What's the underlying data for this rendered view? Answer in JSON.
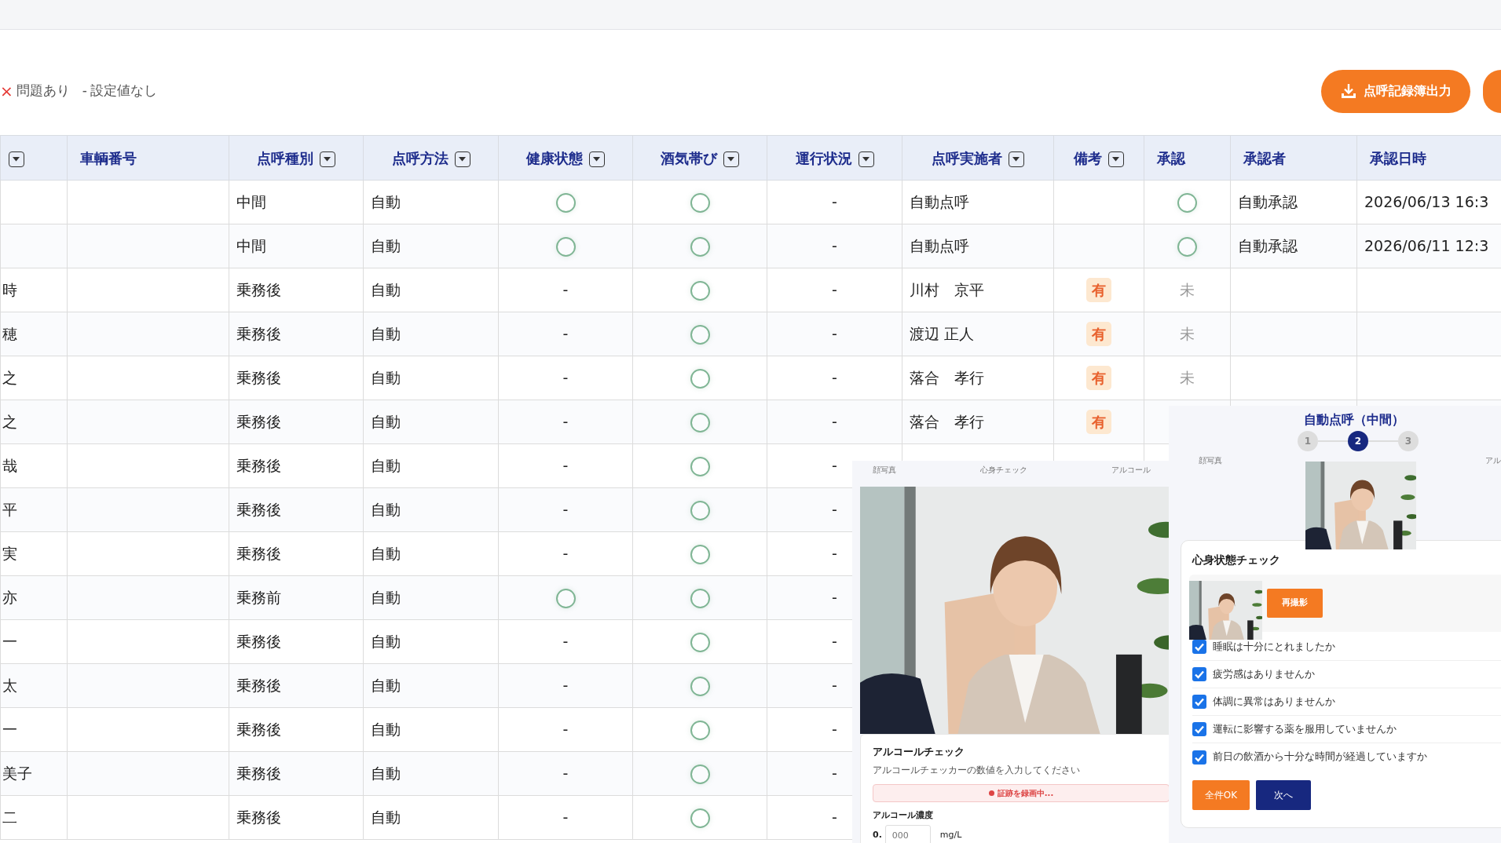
{
  "legend": [
    {
      "kind": "problem",
      "icon": "×",
      "label": "問題あり"
    },
    {
      "kind": "unset",
      "icon": "-",
      "label": "設定値なし"
    }
  ],
  "actions": [
    {
      "kind": "export",
      "label": "点呼記録簿出力"
    },
    {
      "kind": "cut"
    }
  ],
  "table": {
    "columns": [
      {
        "filter": true
      },
      {
        "label": "車輌番号",
        "filter": false
      },
      {
        "label": "点呼種別",
        "filter": true
      },
      {
        "label": "点呼方法",
        "filter": true
      },
      {
        "label": "健康状態",
        "filter": true
      },
      {
        "label": "酒気帯び",
        "filter": true
      },
      {
        "label": "運行状況",
        "filter": true
      },
      {
        "label": "点呼実施者",
        "filter": true
      },
      {
        "label": "備考",
        "filter": true
      },
      {
        "label": "承認",
        "filter": false
      },
      {
        "label": "承認者",
        "filter": false
      },
      {
        "label": "承認日時",
        "filter": false
      }
    ],
    "rows": [
      {
        "cells": [
          {
            "kind": "empty"
          },
          {
            "kind": "empty"
          },
          {
            "kind": "text",
            "text": "中間"
          },
          {
            "kind": "text",
            "text": "自動"
          },
          {
            "kind": "circle"
          },
          {
            "kind": "circle"
          },
          {
            "kind": "dash",
            "text": "-"
          },
          {
            "kind": "text",
            "text": "自動点呼"
          },
          {
            "kind": "empty"
          },
          {
            "kind": "circle"
          },
          {
            "kind": "text",
            "text": "自動承認"
          },
          {
            "kind": "text",
            "text": "2026/06/13 16:3"
          }
        ]
      },
      {
        "cells": [
          {
            "kind": "empty"
          },
          {
            "kind": "empty"
          },
          {
            "kind": "text",
            "text": "中間"
          },
          {
            "kind": "text",
            "text": "自動"
          },
          {
            "kind": "circle"
          },
          {
            "kind": "circle"
          },
          {
            "kind": "dash",
            "text": "-"
          },
          {
            "kind": "text",
            "text": "自動点呼"
          },
          {
            "kind": "empty"
          },
          {
            "kind": "circle"
          },
          {
            "kind": "text",
            "text": "自動承認"
          },
          {
            "kind": "text",
            "text": "2026/06/11 12:3"
          }
        ]
      },
      {
        "cells": [
          {
            "kind": "text",
            "text": "時"
          },
          {
            "kind": "empty"
          },
          {
            "kind": "text",
            "text": "乗務後"
          },
          {
            "kind": "text",
            "text": "自動"
          },
          {
            "kind": "dash",
            "text": "-"
          },
          {
            "kind": "circle"
          },
          {
            "kind": "dash",
            "text": "-"
          },
          {
            "kind": "text",
            "text": "川村　京平"
          },
          {
            "kind": "badge",
            "text": "有"
          },
          {
            "kind": "muted",
            "text": "未"
          }
        ]
      },
      {
        "cells": [
          {
            "kind": "text",
            "text": "穂"
          },
          {
            "kind": "empty"
          },
          {
            "kind": "text",
            "text": "乗務後"
          },
          {
            "kind": "text",
            "text": "自動"
          },
          {
            "kind": "dash",
            "text": "-"
          },
          {
            "kind": "circle"
          },
          {
            "kind": "dash",
            "text": "-"
          },
          {
            "kind": "text",
            "text": "渡辺 正人"
          },
          {
            "kind": "badge",
            "text": "有"
          },
          {
            "kind": "muted",
            "text": "未"
          }
        ]
      },
      {
        "cells": [
          {
            "kind": "text",
            "text": "之"
          },
          {
            "kind": "empty"
          },
          {
            "kind": "text",
            "text": "乗務後"
          },
          {
            "kind": "text",
            "text": "自動"
          },
          {
            "kind": "dash",
            "text": "-"
          },
          {
            "kind": "circle"
          },
          {
            "kind": "dash",
            "text": "-"
          },
          {
            "kind": "text",
            "text": "落合　孝行"
          },
          {
            "kind": "badge",
            "text": "有"
          },
          {
            "kind": "muted",
            "text": "未"
          }
        ]
      },
      {
        "cells": [
          {
            "kind": "text",
            "text": "之"
          },
          {
            "kind": "empty"
          },
          {
            "kind": "text",
            "text": "乗務後"
          },
          {
            "kind": "text",
            "text": "自動"
          },
          {
            "kind": "dash",
            "text": "-"
          },
          {
            "kind": "circle"
          },
          {
            "kind": "dash",
            "text": "-"
          },
          {
            "kind": "text",
            "text": "落合　孝行"
          },
          {
            "kind": "badge",
            "text": "有"
          }
        ]
      },
      {
        "cells": [
          {
            "kind": "text",
            "text": "哉"
          },
          {
            "kind": "empty"
          },
          {
            "kind": "text",
            "text": "乗務後"
          },
          {
            "kind": "text",
            "text": "自動"
          },
          {
            "kind": "dash",
            "text": "-"
          },
          {
            "kind": "circle"
          },
          {
            "kind": "dash",
            "text": "-"
          }
        ]
      },
      {
        "cells": [
          {
            "kind": "text",
            "text": "平"
          },
          {
            "kind": "empty"
          },
          {
            "kind": "text",
            "text": "乗務後"
          },
          {
            "kind": "text",
            "text": "自動"
          },
          {
            "kind": "dash",
            "text": "-"
          },
          {
            "kind": "circle"
          },
          {
            "kind": "dash",
            "text": "-"
          }
        ]
      },
      {
        "cells": [
          {
            "kind": "text",
            "text": "実"
          },
          {
            "kind": "empty"
          },
          {
            "kind": "text",
            "text": "乗務後"
          },
          {
            "kind": "text",
            "text": "自動"
          },
          {
            "kind": "dash",
            "text": "-"
          },
          {
            "kind": "circle"
          },
          {
            "kind": "dash",
            "text": "-"
          }
        ]
      },
      {
        "cells": [
          {
            "kind": "text",
            "text": "亦"
          },
          {
            "kind": "empty"
          },
          {
            "kind": "text",
            "text": "乗務前"
          },
          {
            "kind": "text",
            "text": "自動"
          },
          {
            "kind": "circle"
          },
          {
            "kind": "circle"
          },
          {
            "kind": "dash",
            "text": "-"
          }
        ]
      },
      {
        "cells": [
          {
            "kind": "text",
            "text": "一"
          },
          {
            "kind": "empty"
          },
          {
            "kind": "text",
            "text": "乗務後"
          },
          {
            "kind": "text",
            "text": "自動"
          },
          {
            "kind": "dash",
            "text": "-"
          },
          {
            "kind": "circle"
          },
          {
            "kind": "dash",
            "text": "-"
          }
        ]
      },
      {
        "cells": [
          {
            "kind": "text",
            "text": "太"
          },
          {
            "kind": "empty"
          },
          {
            "kind": "text",
            "text": "乗務後"
          },
          {
            "kind": "text",
            "text": "自動"
          },
          {
            "kind": "dash",
            "text": "-"
          },
          {
            "kind": "circle"
          },
          {
            "kind": "dash",
            "text": "-"
          }
        ]
      },
      {
        "cells": [
          {
            "kind": "text",
            "text": "一"
          },
          {
            "kind": "empty"
          },
          {
            "kind": "text",
            "text": "乗務後"
          },
          {
            "kind": "text",
            "text": "自動"
          },
          {
            "kind": "dash",
            "text": "-"
          },
          {
            "kind": "circle"
          },
          {
            "kind": "dash",
            "text": "-"
          }
        ]
      },
      {
        "cells": [
          {
            "kind": "text",
            "text": "美子"
          },
          {
            "kind": "empty"
          },
          {
            "kind": "text",
            "text": "乗務後"
          },
          {
            "kind": "text",
            "text": "自動"
          },
          {
            "kind": "dash",
            "text": "-"
          },
          {
            "kind": "circle"
          },
          {
            "kind": "dash",
            "text": "-"
          }
        ]
      },
      {
        "cells": [
          {
            "kind": "text",
            "text": "二"
          },
          {
            "kind": "empty"
          },
          {
            "kind": "text",
            "text": "乗務後"
          },
          {
            "kind": "text",
            "text": "自動"
          },
          {
            "kind": "dash",
            "text": "-"
          },
          {
            "kind": "circle"
          },
          {
            "kind": "dash",
            "text": "-"
          }
        ]
      }
    ]
  },
  "alcohol_panel": {
    "steps": [
      {
        "label": "顔写真"
      },
      {
        "label": "心身チェック"
      },
      {
        "label": "アルコール"
      }
    ],
    "title": "アルコールチェック",
    "hint": "アルコールチェッカーの数値を入力してください",
    "recording": "証跡を録画中...",
    "field_label": "アルコール濃度",
    "prefix": "0.",
    "placeholder": "000",
    "unit": "mg/L"
  },
  "check_panel": {
    "title": "自動点呼（中間）",
    "steps": [
      {
        "number": "1",
        "selected": false
      },
      {
        "number": "2",
        "selected": true
      },
      {
        "number": "3",
        "selected": false
      }
    ],
    "step_labels": [
      "顔写真",
      "アル"
    ],
    "card_title": "心身状態チェック",
    "retake": "再撮影",
    "items": [
      {
        "label": "睡眠は十分にとれましたか",
        "checked": true
      },
      {
        "label": "疲労感はありませんか",
        "checked": true
      },
      {
        "label": "体調に異常はありませんか",
        "checked": true
      },
      {
        "label": "運転に影響する薬を服用していませんか",
        "checked": true
      },
      {
        "label": "前日の飲酒から十分な時間が経過していますか",
        "checked": true
      }
    ],
    "buttons": [
      {
        "kind": "primary",
        "label": "全件OK"
      },
      {
        "kind": "secondary",
        "label": "次へ"
      }
    ]
  }
}
